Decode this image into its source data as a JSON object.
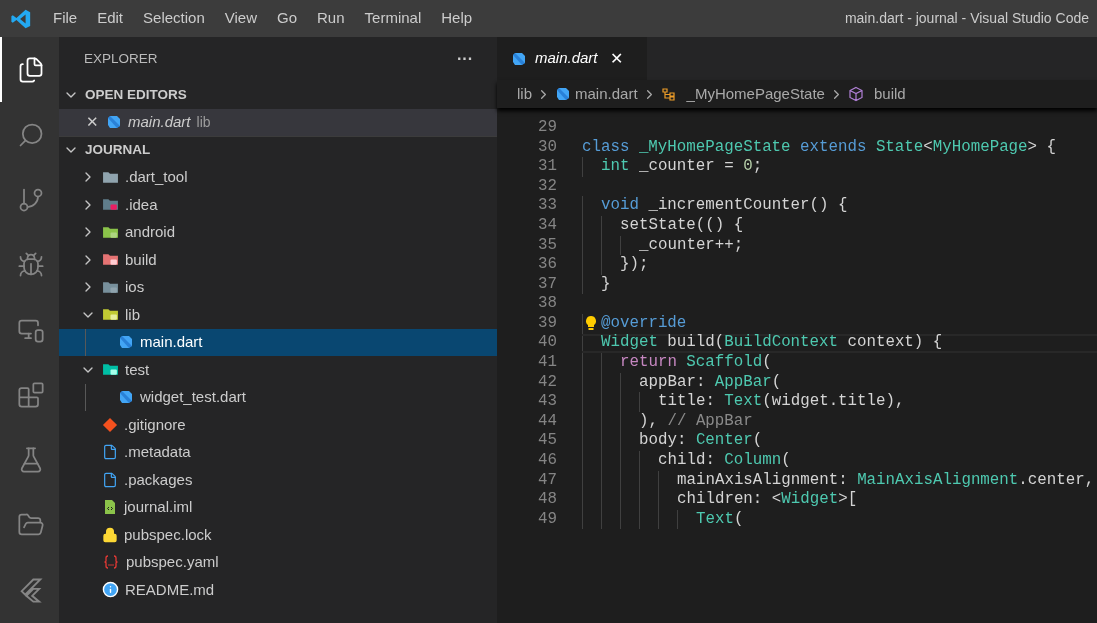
{
  "title_bar": {
    "menus": [
      "File",
      "Edit",
      "Selection",
      "View",
      "Go",
      "Run",
      "Terminal",
      "Help"
    ],
    "title": "main.dart - journal - Visual Studio Code"
  },
  "activity_bar": [
    {
      "kind": "explorer",
      "selected": true
    },
    {
      "kind": "search",
      "selected": false
    },
    {
      "kind": "git",
      "selected": false
    },
    {
      "kind": "debug",
      "selected": false
    },
    {
      "kind": "remote",
      "selected": false
    },
    {
      "kind": "extensions",
      "selected": false
    },
    {
      "kind": "testing",
      "selected": false
    },
    {
      "kind": "folders",
      "selected": false
    },
    {
      "kind": "flutter",
      "selected": false
    }
  ],
  "sidebar": {
    "title": "EXPLORER",
    "more": "···",
    "open_editors": {
      "heading": "OPEN EDITORS",
      "expanded": true,
      "items": [
        {
          "close": "✕",
          "name": "main.dart",
          "path": "lib"
        }
      ]
    },
    "project": {
      "heading": "JOURNAL",
      "expanded": true,
      "items": [
        {
          "name": ".dart_tool",
          "kind": "folder",
          "expanded": false,
          "selected": false
        },
        {
          "name": ".idea",
          "kind": "idea",
          "expanded": false,
          "selected": false
        },
        {
          "name": "android",
          "kind": "android",
          "expanded": false,
          "selected": false
        },
        {
          "name": "build",
          "kind": "build",
          "expanded": false,
          "selected": false
        },
        {
          "name": "ios",
          "kind": "ios",
          "expanded": false,
          "selected": false
        },
        {
          "name": "lib",
          "kind": "lib",
          "expanded": true,
          "selected": false,
          "children": [
            {
              "name": "main.dart",
              "kind": "dart",
              "selected": true
            }
          ]
        },
        {
          "name": "test",
          "kind": "test",
          "expanded": true,
          "selected": false,
          "children": [
            {
              "name": "widget_test.dart",
              "kind": "dart",
              "selected": false
            }
          ]
        },
        {
          "name": ".gitignore",
          "kind": "git",
          "selected": false
        },
        {
          "name": ".metadata",
          "kind": "file",
          "selected": false
        },
        {
          "name": ".packages",
          "kind": "file",
          "selected": false
        },
        {
          "name": "journal.iml",
          "kind": "xml",
          "selected": false
        },
        {
          "name": "pubspec.lock",
          "kind": "lock",
          "selected": false
        },
        {
          "name": "pubspec.yaml",
          "kind": "yaml",
          "selected": false
        },
        {
          "name": "README.md",
          "kind": "info",
          "selected": false
        }
      ]
    }
  },
  "editor": {
    "tabs": [
      {
        "label": "main.dart",
        "close": "✕",
        "selected": true
      }
    ],
    "breadcrumbs": [
      {
        "label": "lib",
        "kind": "folder"
      },
      {
        "label": "main.dart",
        "kind": "dart"
      },
      {
        "label": "_MyHomePageState",
        "kind": "class"
      },
      {
        "label": "build",
        "kind": "method"
      }
    ],
    "lines": [
      {
        "number": "29"
      },
      {
        "number": "30",
        "tokens": [
          {
            "text": "class ",
            "kind": "keyword"
          },
          {
            "text": "_MyHomePageState ",
            "kind": "type"
          },
          {
            "text": "extends ",
            "kind": "keyword"
          },
          {
            "text": "State",
            "kind": "type"
          },
          {
            "text": "<",
            "kind": "plain"
          },
          {
            "text": "MyHomePage",
            "kind": "type"
          },
          {
            "text": "> {",
            "kind": "plain"
          }
        ]
      },
      {
        "number": "31",
        "tokens": [
          {
            "text": "  int",
            "kind": "type"
          },
          {
            "text": " _counter = ",
            "kind": "plain"
          },
          {
            "text": "0",
            "kind": "number"
          },
          {
            "text": ";",
            "kind": "plain"
          }
        ]
      },
      {
        "number": "32"
      },
      {
        "number": "33",
        "tokens": [
          {
            "text": "  void",
            "kind": "keyword"
          },
          {
            "text": " _incrementCounter() {",
            "kind": "plain"
          }
        ]
      },
      {
        "number": "34",
        "tokens": [
          {
            "text": "    setState(() {",
            "kind": "plain"
          }
        ]
      },
      {
        "number": "35",
        "tokens": [
          {
            "text": "      _counter++;",
            "kind": "plain"
          }
        ]
      },
      {
        "number": "36",
        "tokens": [
          {
            "text": "    });",
            "kind": "plain"
          }
        ]
      },
      {
        "number": "37",
        "tokens": [
          {
            "text": "  }",
            "kind": "plain"
          }
        ]
      },
      {
        "number": "38"
      },
      {
        "number": "39",
        "lightbulb": true,
        "tokens": [
          {
            "text": "  @override",
            "kind": "keyword"
          }
        ]
      },
      {
        "number": "40",
        "current": true,
        "tokens": [
          {
            "text": "  Widget",
            "kind": "type"
          },
          {
            "text": " build(",
            "kind": "plain"
          },
          {
            "text": "BuildContext",
            "kind": "type"
          },
          {
            "text": " context) {",
            "kind": "plain"
          }
        ]
      },
      {
        "number": "41",
        "tokens": [
          {
            "text": "    return ",
            "kind": "control"
          },
          {
            "text": "Scaffold",
            "kind": "type"
          },
          {
            "text": "(",
            "kind": "plain"
          }
        ]
      },
      {
        "number": "42",
        "tokens": [
          {
            "text": "      appBar: ",
            "kind": "plain"
          },
          {
            "text": "AppBar",
            "kind": "type"
          },
          {
            "text": "(",
            "kind": "plain"
          }
        ]
      },
      {
        "number": "43",
        "tokens": [
          {
            "text": "        title: ",
            "kind": "plain"
          },
          {
            "text": "Text",
            "kind": "type"
          },
          {
            "text": "(widget.title),",
            "kind": "plain"
          }
        ]
      },
      {
        "number": "44",
        "tokens": [
          {
            "text": "      ), ",
            "kind": "plain"
          },
          {
            "text": "// AppBar",
            "kind": "comment"
          }
        ]
      },
      {
        "number": "45",
        "tokens": [
          {
            "text": "      body: ",
            "kind": "plain"
          },
          {
            "text": "Center",
            "kind": "type"
          },
          {
            "text": "(",
            "kind": "plain"
          }
        ]
      },
      {
        "number": "46",
        "tokens": [
          {
            "text": "        child: ",
            "kind": "plain"
          },
          {
            "text": "Column",
            "kind": "type"
          },
          {
            "text": "(",
            "kind": "plain"
          }
        ]
      },
      {
        "number": "47",
        "tokens": [
          {
            "text": "          mainAxisAlignment: ",
            "kind": "plain"
          },
          {
            "text": "MainAxisAlignment",
            "kind": "type"
          },
          {
            "text": ".center,",
            "kind": "plain"
          }
        ]
      },
      {
        "number": "48",
        "tokens": [
          {
            "text": "          children: <",
            "kind": "plain"
          },
          {
            "text": "Widget",
            "kind": "type"
          },
          {
            "text": ">[",
            "kind": "plain"
          }
        ]
      },
      {
        "number": "49",
        "tokens": [
          {
            "text": "            Text",
            "kind": "type"
          },
          {
            "text": "(",
            "kind": "plain"
          }
        ]
      }
    ]
  }
}
